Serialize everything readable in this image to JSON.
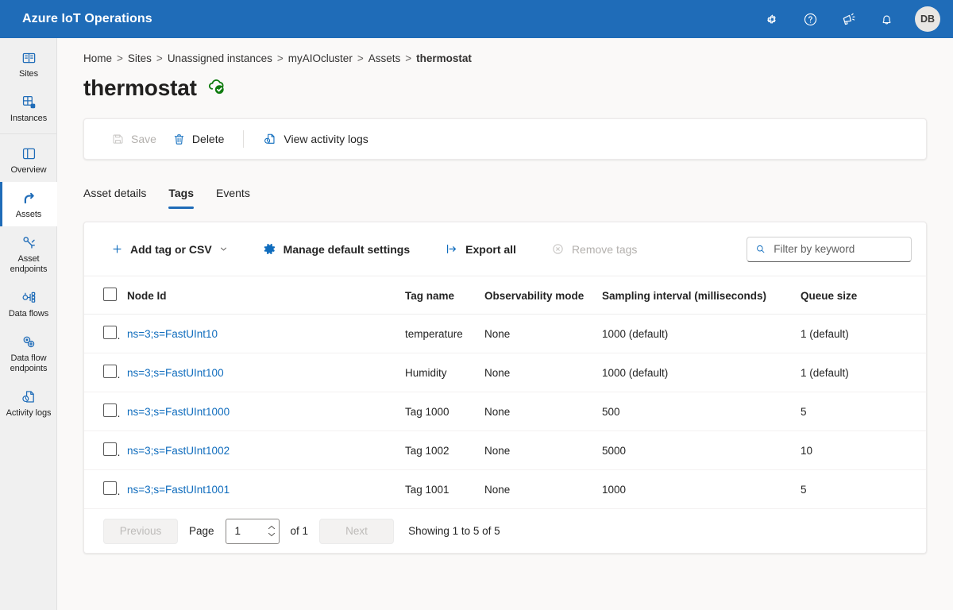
{
  "header": {
    "brand": "Azure IoT Operations",
    "actions": [
      {
        "name": "settings-icon",
        "label": "Settings"
      },
      {
        "name": "help-icon",
        "label": "Help"
      },
      {
        "name": "feedback-icon",
        "label": "Feedback"
      },
      {
        "name": "notifications-icon",
        "label": "Notifications"
      }
    ],
    "avatar_initials": "DB",
    "background_color": "#1f6cb8"
  },
  "sidebar": {
    "items": [
      {
        "label": "Sites",
        "icon": "sites-icon",
        "active": false
      },
      {
        "label": "Instances",
        "icon": "instances-icon",
        "active": false
      },
      {
        "label": "Overview",
        "icon": "overview-icon",
        "active": false
      },
      {
        "label": "Assets",
        "icon": "assets-icon",
        "active": true
      },
      {
        "label": "Asset endpoints",
        "icon": "asset-endpoints-icon",
        "active": false
      },
      {
        "label": "Data flows",
        "icon": "data-flows-icon",
        "active": false
      },
      {
        "label": "Data flow endpoints",
        "icon": "data-flow-endpoints-icon",
        "active": false
      },
      {
        "label": "Activity logs",
        "icon": "activity-logs-icon",
        "active": false
      }
    ],
    "accent_color": "#1f6cb8"
  },
  "breadcrumb": {
    "separator": ">",
    "items": [
      "Home",
      "Sites",
      "Unassigned instances",
      "myAIOcluster",
      "Assets",
      "thermostat"
    ]
  },
  "page": {
    "title": "thermostat",
    "status_icon": "cloud-connected-icon",
    "status_color": "#107c10"
  },
  "command_bar": {
    "save_label": "Save",
    "delete_label": "Delete",
    "view_activity_logs_label": "View activity logs"
  },
  "tabs": [
    {
      "label": "Asset details",
      "active": false
    },
    {
      "label": "Tags",
      "active": true
    },
    {
      "label": "Events",
      "active": false
    }
  ],
  "toolbar": {
    "add_tag_label": "Add tag or CSV",
    "manage_defaults_label": "Manage default settings",
    "export_all_label": "Export all",
    "remove_tags_label": "Remove tags"
  },
  "search": {
    "placeholder": "Filter by keyword",
    "value": ""
  },
  "table": {
    "columns": [
      "Node Id",
      "Tag name",
      "Observability mode",
      "Sampling interval (milliseconds)",
      "Queue size"
    ],
    "rows": [
      {
        "node_id": "ns=3;s=FastUInt10",
        "tag_name": "temperature",
        "observability_mode": "None",
        "sampling_interval": "1000 (default)",
        "queue_size": "1 (default)"
      },
      {
        "node_id": "ns=3;s=FastUInt100",
        "tag_name": "Humidity",
        "observability_mode": "None",
        "sampling_interval": "1000 (default)",
        "queue_size": "1 (default)"
      },
      {
        "node_id": "ns=3;s=FastUInt1000",
        "tag_name": "Tag 1000",
        "observability_mode": "None",
        "sampling_interval": "500",
        "queue_size": "5"
      },
      {
        "node_id": "ns=3;s=FastUInt1002",
        "tag_name": "Tag 1002",
        "observability_mode": "None",
        "sampling_interval": "5000",
        "queue_size": "10"
      },
      {
        "node_id": "ns=3;s=FastUInt1001",
        "tag_name": "Tag 1001",
        "observability_mode": "None",
        "sampling_interval": "1000",
        "queue_size": "5"
      }
    ]
  },
  "pagination": {
    "previous_label": "Previous",
    "page_label": "Page",
    "page_value": "1",
    "of_label": "of 1",
    "next_label": "Next",
    "showing_label": "Showing 1 to 5 of 5"
  }
}
